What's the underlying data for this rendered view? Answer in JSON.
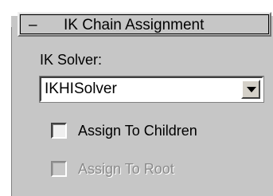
{
  "rollout": {
    "collapse_glyph": "–",
    "title": "IK Chain Assignment"
  },
  "solver": {
    "label": "IK Solver:",
    "selected": "IKHISolver",
    "dropdown_icon": "chevron-down-icon"
  },
  "options": [
    {
      "label": "Assign To Children",
      "checked": false,
      "enabled": true
    },
    {
      "label": "Assign To Root",
      "checked": false,
      "enabled": false
    }
  ],
  "colors": {
    "panel_bg": "#c6c6c6",
    "disabled_text": "#8a8a8a"
  }
}
